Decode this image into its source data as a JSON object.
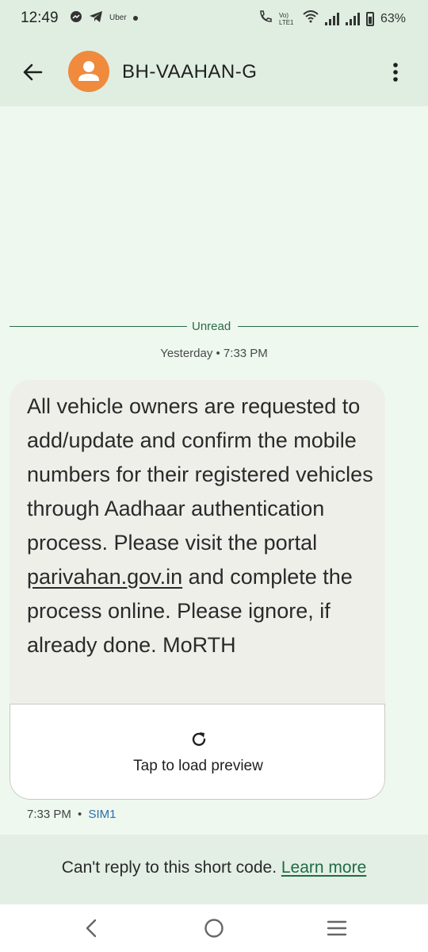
{
  "status_bar": {
    "time": "12:49",
    "notification_icons": [
      "messenger-icon",
      "telegram-icon",
      "uber-icon",
      "dot-icon"
    ],
    "uber_label": "Uber",
    "network_label": "Vo) LTE1",
    "battery": "63%"
  },
  "header": {
    "title": "BH-VAAHAN-G",
    "avatar_color": "#f08a3c"
  },
  "conversation": {
    "unread_label": "Unread",
    "date_stamp": "Yesterday • 7:33 PM",
    "message": {
      "text_before_link": "All vehicle owners are requested to add/update and confirm the mobile numbers for their registered vehicles through Aadhaar authentication process. Please visit the portal ",
      "link": "parivahan.gov.in",
      "text_after_link": " and complete the process online. Please ignore, if already done. MoRTH",
      "preview_label": "Tap to load preview",
      "time": "7:33 PM",
      "separator": "•",
      "sim": "SIM1"
    }
  },
  "footer": {
    "reply_text": "Can't reply to this short code. ",
    "learn_more": "Learn more"
  },
  "colors": {
    "background": "#eef8ef",
    "bubble": "#efefea",
    "accent_green": "#2c6a47",
    "sim_blue": "#2c6dae"
  }
}
